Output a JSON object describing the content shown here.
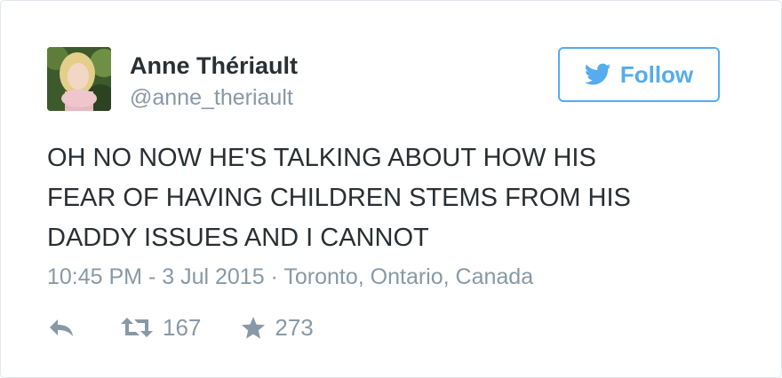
{
  "author": {
    "display_name": "Anne Thériault",
    "handle": "@anne_theriault"
  },
  "follow_button": {
    "label": "Follow",
    "icon": "twitter-bird-icon"
  },
  "tweet": {
    "lines": [
      "OH NO NOW HE'S TALKING ABOUT HOW HIS",
      "FEAR OF HAVING CHILDREN STEMS FROM HIS",
      "DADDY ISSUES AND I CANNOT"
    ],
    "time": "10:45 PM - 3 Jul 2015",
    "separator": "·",
    "location": "Toronto, Ontario, Canada"
  },
  "actions": {
    "reply": {
      "icon": "reply-icon"
    },
    "retweet": {
      "icon": "retweet-icon",
      "count": "167"
    },
    "favorite": {
      "icon": "star-icon",
      "count": "273"
    }
  },
  "colors": {
    "accent": "#55acee",
    "text": "#292f33",
    "muted": "#8899a6",
    "border": "#e1e8ed"
  }
}
